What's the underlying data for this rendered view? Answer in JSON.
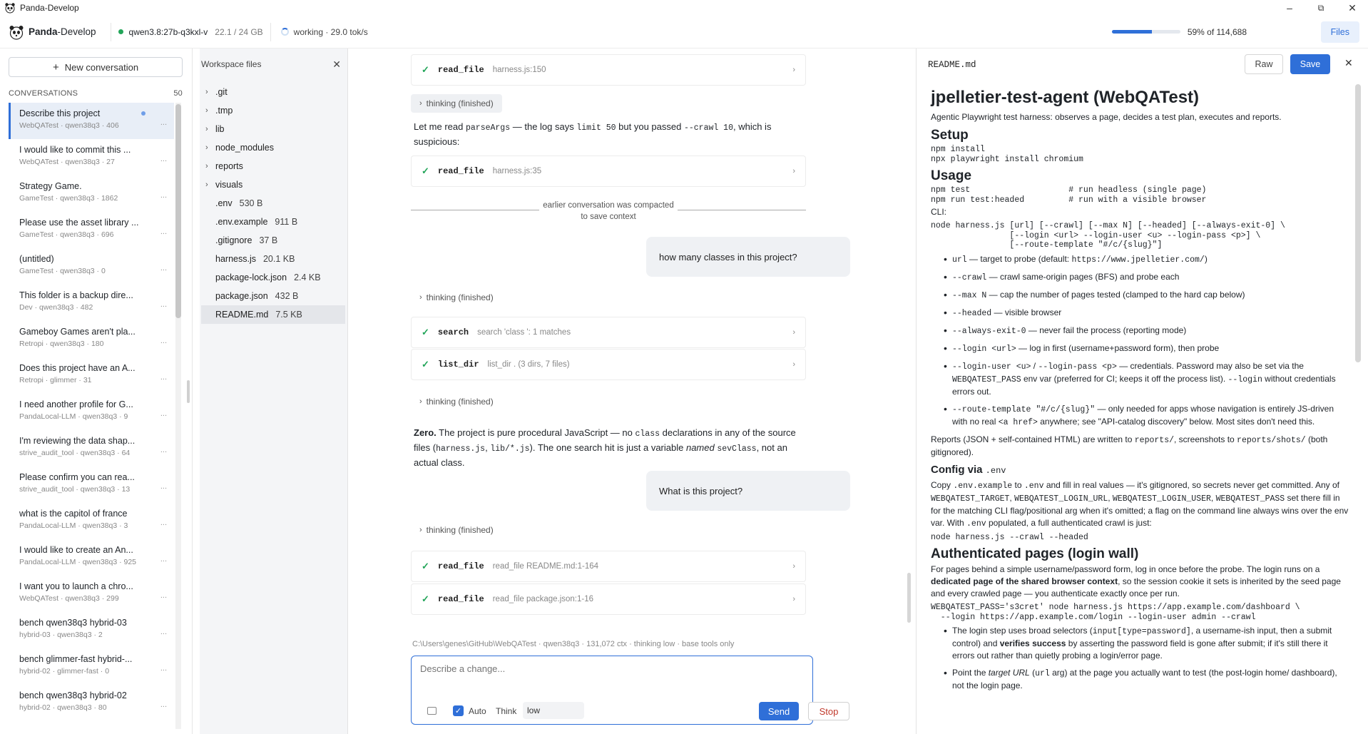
{
  "window": {
    "title": "Panda-Develop"
  },
  "header": {
    "brand_bold": "Panda",
    "brand_rest": "-Develop",
    "model": "qwen3.8:27b-q3kxl-v",
    "memory": "22.1 / 24 GB",
    "status": "working · 29.0 tok/s",
    "context_percent": 59,
    "context_label": "59% of 114,688",
    "files_button": "Files"
  },
  "sidebar": {
    "new_conversation": "New conversation",
    "section_label": "CONVERSATIONS",
    "count": "50",
    "items": [
      {
        "title": "Describe this project",
        "meta": "WebQATest · qwen38q3 · 406"
      },
      {
        "title": "I would like to commit this ...",
        "meta": "WebQATest · qwen38q3 · 27"
      },
      {
        "title": "Strategy Game.",
        "meta": "GameTest · qwen38q3 · 1862"
      },
      {
        "title": "Please use the asset library ...",
        "meta": "GameTest · qwen38q3 · 696"
      },
      {
        "title": "(untitled)",
        "meta": "GameTest · qwen38q3 · 0"
      },
      {
        "title": "This folder is a backup dire...",
        "meta": "Dev · qwen38q3 · 482"
      },
      {
        "title": "Gameboy Games aren't pla...",
        "meta": "Retropi · qwen38q3 · 180"
      },
      {
        "title": "Does this project have an A...",
        "meta": "Retropi · glimmer · 31"
      },
      {
        "title": "I need another profile for G...",
        "meta": "PandaLocal-LLM · qwen38q3 · 9"
      },
      {
        "title": "I'm reviewing the data shap...",
        "meta": "strive_audit_tool · qwen38q3 · 64"
      },
      {
        "title": "Please confirm you can rea...",
        "meta": "strive_audit_tool · qwen38q3 · 13"
      },
      {
        "title": "what is the capitol of france",
        "meta": "PandaLocal-LLM · qwen38q3 · 3"
      },
      {
        "title": "I would like to create an An...",
        "meta": "PandaLocal-LLM · qwen38q3 · 925"
      },
      {
        "title": "I want you to launch a chro...",
        "meta": "WebQATest · qwen38q3 · 299"
      },
      {
        "title": "bench qwen38q3 hybrid-03",
        "meta": "hybrid-03 · qwen38q3 · 2"
      },
      {
        "title": "bench glimmer-fast hybrid-...",
        "meta": "hybrid-02 · glimmer-fast · 0"
      },
      {
        "title": "bench qwen38q3 hybrid-02",
        "meta": "hybrid-02 · qwen38q3 · 80"
      }
    ]
  },
  "files": {
    "title": "Workspace files",
    "folders": [
      ".git",
      ".tmp",
      "lib",
      "node_modules",
      "reports",
      "visuals"
    ],
    "items": [
      {
        "name": ".env",
        "size": "530 B"
      },
      {
        "name": ".env.example",
        "size": "911 B"
      },
      {
        "name": ".gitignore",
        "size": "37 B"
      },
      {
        "name": "harness.js",
        "size": "20.1 KB"
      },
      {
        "name": "package-lock.json",
        "size": "2.4 KB"
      },
      {
        "name": "package.json",
        "size": "432 B"
      },
      {
        "name": "README.md",
        "size": "7.5 KB"
      }
    ]
  },
  "chat": {
    "tool1": {
      "name": "read_file",
      "args": "harness.js:150"
    },
    "thinking": "thinking (finished)",
    "msg1_a": "Let me read ",
    "msg1_code1": "parseArgs",
    "msg1_b": " — the log says ",
    "msg1_code2": "limit 50",
    "msg1_c": " but you passed ",
    "msg1_code3": "--crawl 10",
    "msg1_d": ", which is suspicious:",
    "tool2": {
      "name": "read_file",
      "args": "harness.js:35"
    },
    "compact_note": "earlier conversation was compacted to save context",
    "user1": "how many classes in this project?",
    "tool3": {
      "name": "search",
      "args": "search 'class ': 1 matches"
    },
    "tool4": {
      "name": "list_dir",
      "args": "list_dir . (3 dirs, 7 files)"
    },
    "answer_bold": "Zero.",
    "answer_a": " The project is pure procedural JavaScript — no ",
    "answer_code1": "class",
    "answer_b": " declarations in any of the source files (",
    "answer_code2": "harness.js",
    "answer_c": ", ",
    "answer_code3": "lib/*.js",
    "answer_d": "). The one search hit is just a variable ",
    "answer_em": "named",
    "answer_code4": "sevClass",
    "answer_e": ", not an actual class.",
    "user2": "What is this project?",
    "tool5": {
      "name": "read_file",
      "args": "read_file README.md:1-164"
    },
    "tool6": {
      "name": "read_file",
      "args": "read_file package.json:1-16"
    },
    "context_bar": "C:\\Users\\genes\\GitHub\\WebQATest · qwen38q3 · 131,072 ctx · thinking low · base tools only",
    "composer": {
      "placeholder": "Describe a change...",
      "auto_label": "Auto",
      "think_label": "Think",
      "think_value": "low",
      "send": "Send",
      "stop": "Stop"
    }
  },
  "readme": {
    "filename": "README.md",
    "raw": "Raw",
    "save": "Save",
    "h1": "jpelletier-test-agent (WebQATest)",
    "intro": "Agentic Playwright test harness: observes a page, decides a test plan, executes and reports.",
    "setup_h": "Setup",
    "setup_code": "npm install\nnpx playwright install chromium",
    "usage_h": "Usage",
    "usage_code": "npm test                    # run headless (single page)\nnpm run test:headed         # run with a visible browser",
    "cli_label": "CLI:",
    "cli_code": "node harness.js [url] [--crawl] [--max N] [--headed] [--always-exit-0] \\\n                [--login <url> --login-user <u> --login-pass <p>] \\\n                [--route-template \"#/c/{slug}\"]",
    "b1_code": "url",
    "b1_text": " — target to probe (default: ",
    "b1_code2": "https://www.jpelletier.com/",
    "b1_end": ")",
    "b2_code": "--crawl",
    "b2_text": " — crawl same-origin pages (BFS) and probe each",
    "b3_code": "--max N",
    "b3_text": " — cap the number of pages tested (clamped to the hard cap below)",
    "b4_code": "--headed",
    "b4_text": " — visible browser",
    "b5_code": "--always-exit-0",
    "b5_text": " — never fail the process (reporting mode)",
    "b6_code": "--login <url>",
    "b6_text": " — log in first (username+password form), then probe",
    "b7_code": "--login-user <u>",
    "b7_sep": " / ",
    "b7_code2": "--login-pass <p>",
    "b7_text": " — credentials. Password may also be set via the ",
    "b7_code3": "WEBQATEST_PASS",
    "b7_text2": " env var (preferred for CI; keeps it off the process list). ",
    "b7_code4": "--login",
    "b7_text3": " without credentials errors out.",
    "b8_code": "--route-template \"#/c/{slug}\"",
    "b8_text": " — only needed for apps whose navigation is entirely JS-driven with no real ",
    "b8_code2": "<a href>",
    "b8_text2": " anywhere; see \"API-catalog discovery\" below. Most sites don't need this.",
    "reports_a": "Reports (JSON + self-contained HTML) are written to ",
    "reports_code1": "reports/",
    "reports_b": ", screenshots to ",
    "reports_code2": "reports/shots/",
    "reports_c": " (both gitignored).",
    "config_h": "Config via ",
    "config_h_code": ".env",
    "config_a": "Copy ",
    "config_code1": ".env.example",
    "config_b": " to ",
    "config_code2": ".env",
    "config_c": " and fill in real values — it's gitignored, so secrets never get committed. Any of ",
    "config_code3": "WEBQATEST_TARGET",
    "config_d": ", ",
    "config_code4": "WEBQATEST_LOGIN_URL",
    "config_code5": "WEBQATEST_LOGIN_USER",
    "config_code6": "WEBQATEST_PASS",
    "config_e": " set there fill in for the matching CLI flag/positional arg when it's omitted; a flag on the command line always wins over the env var. With ",
    "config_code7": ".env",
    "config_f": " populated, a full authenticated crawl is just:",
    "config_cmd": "node harness.js --crawl --headed",
    "auth_h": "Authenticated pages (login wall)",
    "auth_a": "For pages behind a simple username/password form, log in once before the probe. The login runs on a ",
    "auth_bold": "dedicated page of the shared browser context",
    "auth_b": ", so the session cookie it sets is inherited by the seed page and every crawled page — you authenticate exactly once per run.",
    "auth_code": "WEBQATEST_PASS='s3cret' node harness.js https://app.example.com/dashboard \\\n  --login https://app.example.com/login --login-user admin --crawl",
    "a1_a": "The login step uses broad selectors (",
    "a1_code": "input[type=password]",
    "a1_b": ", a username-ish input, then a submit control) and ",
    "a1_bold": "verifies success",
    "a1_c": " by asserting the password field is gone after submit; if it's still there it errors out rather than quietly probing a login/error page.",
    "a2_a": "Point the ",
    "a2_em": "target URL",
    "a2_b": " (",
    "a2_code": "url",
    "a2_c": " arg) at the page you actually want to test (the post-login home/ dashboard), not the login page."
  }
}
